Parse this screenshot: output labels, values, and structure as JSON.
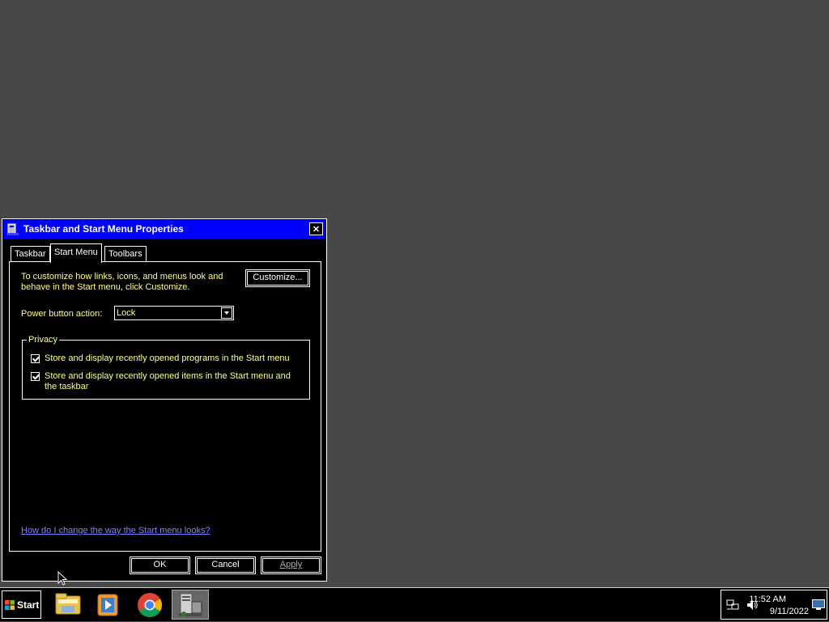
{
  "dialog": {
    "title": "Taskbar and Start Menu Properties",
    "close_symbol": "✕",
    "tabs": [
      {
        "label": "Taskbar",
        "active": false
      },
      {
        "label": "Start Menu",
        "active": true
      },
      {
        "label": "Toolbars",
        "active": false
      }
    ],
    "start_menu": {
      "description": "To customize how links, icons, and menus look and behave in the Start menu, click Customize.",
      "customize_label": "Customize...",
      "power_button_label": "Power button action:",
      "power_button_value": "Lock",
      "privacy": {
        "legend": "Privacy",
        "items": [
          {
            "label": "Store and display recently opened programs in the Start menu",
            "checked": true
          },
          {
            "label": "Store and display recently opened items in the Start menu and the taskbar",
            "checked": true
          }
        ]
      },
      "help_link": "How do I change the way the Start menu looks?"
    },
    "buttons": {
      "ok": "OK",
      "cancel": "Cancel",
      "apply": "Apply"
    }
  },
  "taskbar": {
    "start_label": "Start",
    "apps": [
      {
        "icon": "file-explorer-icon"
      },
      {
        "icon": "media-player-icon"
      },
      {
        "icon": "chrome-icon"
      },
      {
        "icon": "server-manager-icon",
        "active": true
      }
    ],
    "tray_icons": [
      "network-icon",
      "volume-icon",
      "show-desktop-icon"
    ],
    "clock": {
      "time": "11:52 AM",
      "date": "9/11/2022"
    }
  },
  "colors": {
    "desktop": "#484848",
    "title_bar": "#0000ff",
    "dialog_bg": "#000000",
    "highlight_text": "#ffff80",
    "link": "#8080ff"
  }
}
